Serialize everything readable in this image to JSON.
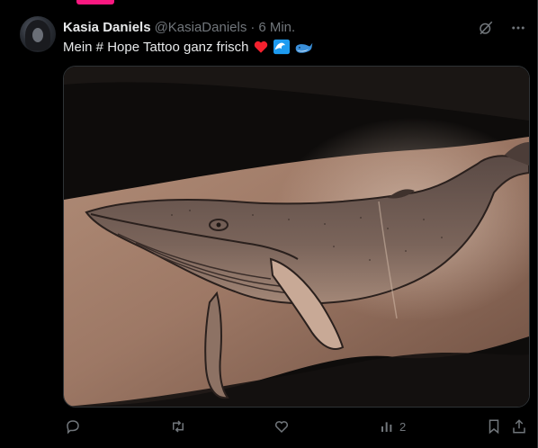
{
  "post": {
    "author_name": "Kasia Daniels",
    "author_handle": "@KasiaDaniels",
    "separator": "·",
    "time": "6 Min.",
    "text": "Mein # Hope Tattoo ganz frisch",
    "emojis": [
      "heart-emoji",
      "wave-emoji",
      "whale-emoji"
    ]
  },
  "actions": {
    "views_count": "2"
  },
  "icons": {
    "grok": "grok-icon",
    "more": "more-icon",
    "reply": "reply-icon",
    "repost": "repost-icon",
    "like": "like-icon",
    "views": "views-icon",
    "bookmark": "bookmark-icon",
    "share": "share-icon"
  },
  "colors": {
    "background": "#000000",
    "text": "#e7e9ea",
    "muted": "#71767b",
    "accent_tab": "#f91880",
    "heart": "#f4212e",
    "water": "#1d9bf0"
  }
}
